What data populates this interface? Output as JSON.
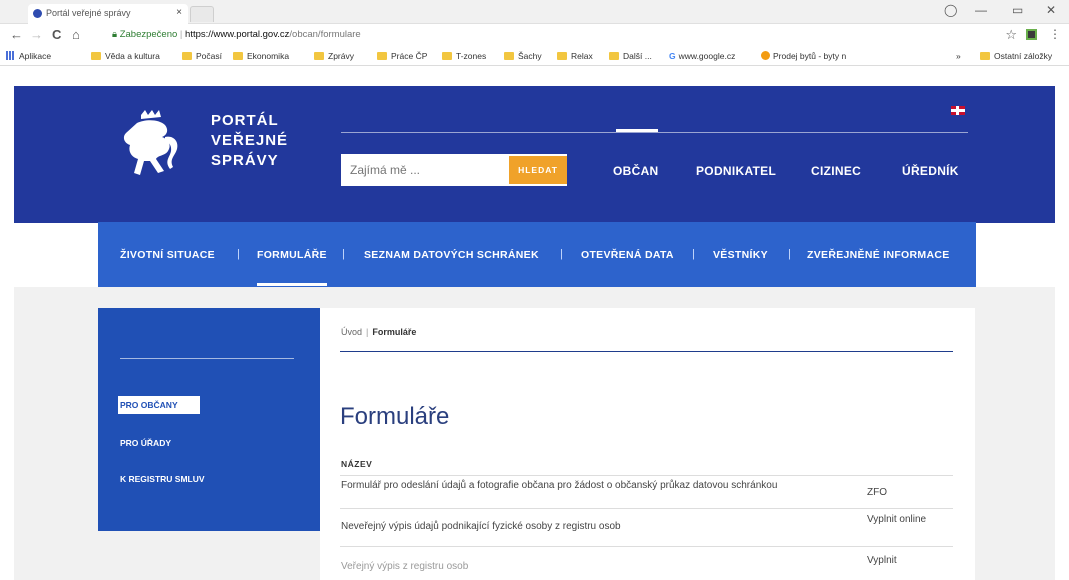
{
  "browser": {
    "tab_title": "Portál veřejné správy",
    "tab_close": "×",
    "nav": {
      "back": "←",
      "forward": "→",
      "reload": "C",
      "home": "⌂"
    },
    "url_secure": "Zabezpečeno",
    "url_prefix": "https://",
    "url_host": "www.portal.gov.cz",
    "url_path": "/obcan/formulare",
    "star": "☆",
    "menu": "⋮",
    "window": {
      "minimize": "—",
      "restore": "▭",
      "close": "✕"
    }
  },
  "bookmarks": {
    "apps": "Aplikace",
    "items": [
      "Věda a kultura",
      "Počasí",
      "Ekonomika",
      "Zprávy",
      "Práce ČP",
      "T-zones",
      "Šachy",
      "Relax",
      "Další ..."
    ],
    "google": "www.google.cz",
    "prodej": "Prodej bytů - byty n",
    "more": "»",
    "other": "Ostatní záložky"
  },
  "header": {
    "logo_line1": "PORTÁL",
    "logo_line2": "VEŘEJNÉ",
    "logo_line3": "SPRÁVY",
    "search_placeholder": "Zajímá mě ...",
    "search_button": "HLEDAT",
    "nav": [
      "OBČAN",
      "PODNIKATEL",
      "CIZINEC",
      "ÚŘEDNÍK"
    ]
  },
  "subnav": {
    "items": [
      "ŽIVOTNÍ SITUACE",
      "FORMULÁŘE",
      "SEZNAM DATOVÝCH SCHRÁNEK",
      "OTEVŘENÁ DATA",
      "VĚSTNÍKY",
      "ZVEŘEJNĚNÉ INFORMACE"
    ],
    "separator": "|",
    "active": "FORMULÁŘE"
  },
  "sidebar": {
    "items": [
      "PRO OBČANY",
      "PRO ÚŘADY",
      "K REGISTRU SMLUV"
    ],
    "active": "PRO OBČANY"
  },
  "content": {
    "breadcrumb_home": "Úvod",
    "breadcrumb_sep": "|",
    "breadcrumb_current": "Formuláře",
    "title": "Formuláře",
    "column_header": "NÁZEV",
    "rows": [
      {
        "name": "Formulář pro odeslání údajů a fotografie občana pro žádost o občanský průkaz datovou schránkou",
        "action": "ZFO"
      },
      {
        "name": "Neveřejný výpis údajů podnikající fyzické osoby z registru osob",
        "action": "Vyplnit online"
      },
      {
        "name": "Veřejný výpis z registru osob",
        "action": "Vyplnit"
      }
    ]
  },
  "colors": {
    "header_blue": "#22389c",
    "subnav_blue": "#2d63cc",
    "sidebar_blue": "#2050b5",
    "search_orange": "#f0a22a",
    "title_blue": "#2a3f7e"
  }
}
